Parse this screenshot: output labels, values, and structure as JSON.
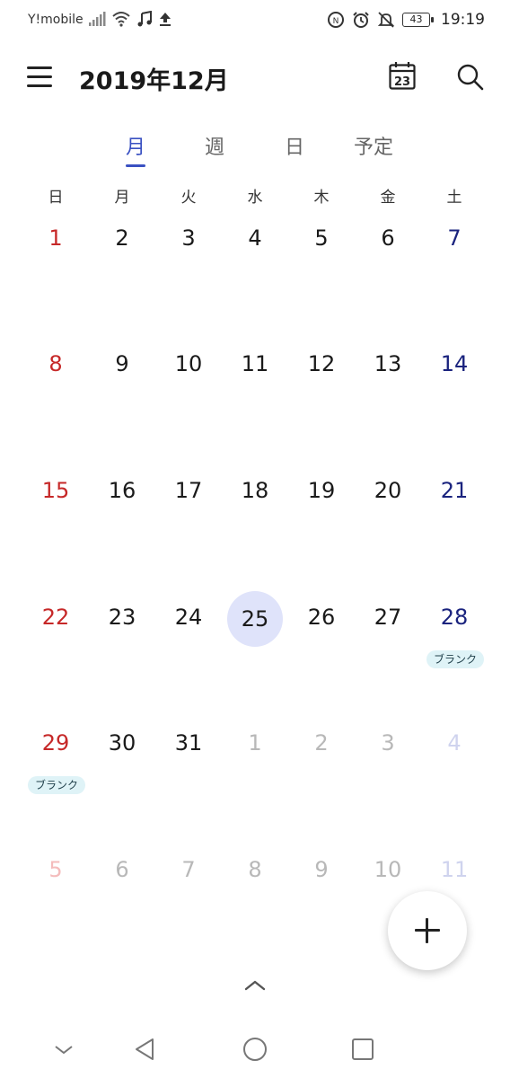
{
  "status_bar": {
    "carrier": "Y!mobile",
    "battery": "43",
    "time": "19:19"
  },
  "header": {
    "title": "2019年12月",
    "today_badge": "23"
  },
  "tabs": [
    {
      "label": "月"
    },
    {
      "label": "週"
    },
    {
      "label": "日"
    },
    {
      "label": "予定"
    }
  ],
  "weekdays": [
    "日",
    "月",
    "火",
    "水",
    "木",
    "金",
    "土"
  ],
  "weeks": [
    [
      "1",
      "2",
      "3",
      "4",
      "5",
      "6",
      "7"
    ],
    [
      "8",
      "9",
      "10",
      "11",
      "12",
      "13",
      "14"
    ],
    [
      "15",
      "16",
      "17",
      "18",
      "19",
      "20",
      "21"
    ],
    [
      "22",
      "23",
      "24",
      "25",
      "26",
      "27",
      "28"
    ],
    [
      "29",
      "30",
      "31",
      "1",
      "2",
      "3",
      "4"
    ],
    [
      "5",
      "6",
      "7",
      "8",
      "9",
      "10",
      "11"
    ]
  ],
  "events": {
    "dec28": "ブランク",
    "dec29": "ブランク"
  },
  "colors": {
    "accent": "#3a51c2",
    "sunday": "#c62828",
    "saturday": "#1a237e",
    "today_highlight": "#dfe3fa",
    "event_chip": "#dff3f7"
  },
  "icons": {
    "menu": "hamburger-menu-icon",
    "today": "calendar-today-icon",
    "search": "search-icon",
    "add": "plus-icon",
    "expand": "chevron-up-icon",
    "nav_hide": "chevron-down-icon",
    "nav_back": "triangle-back-icon",
    "nav_home": "circle-home-icon",
    "nav_recent": "square-recents-icon"
  }
}
